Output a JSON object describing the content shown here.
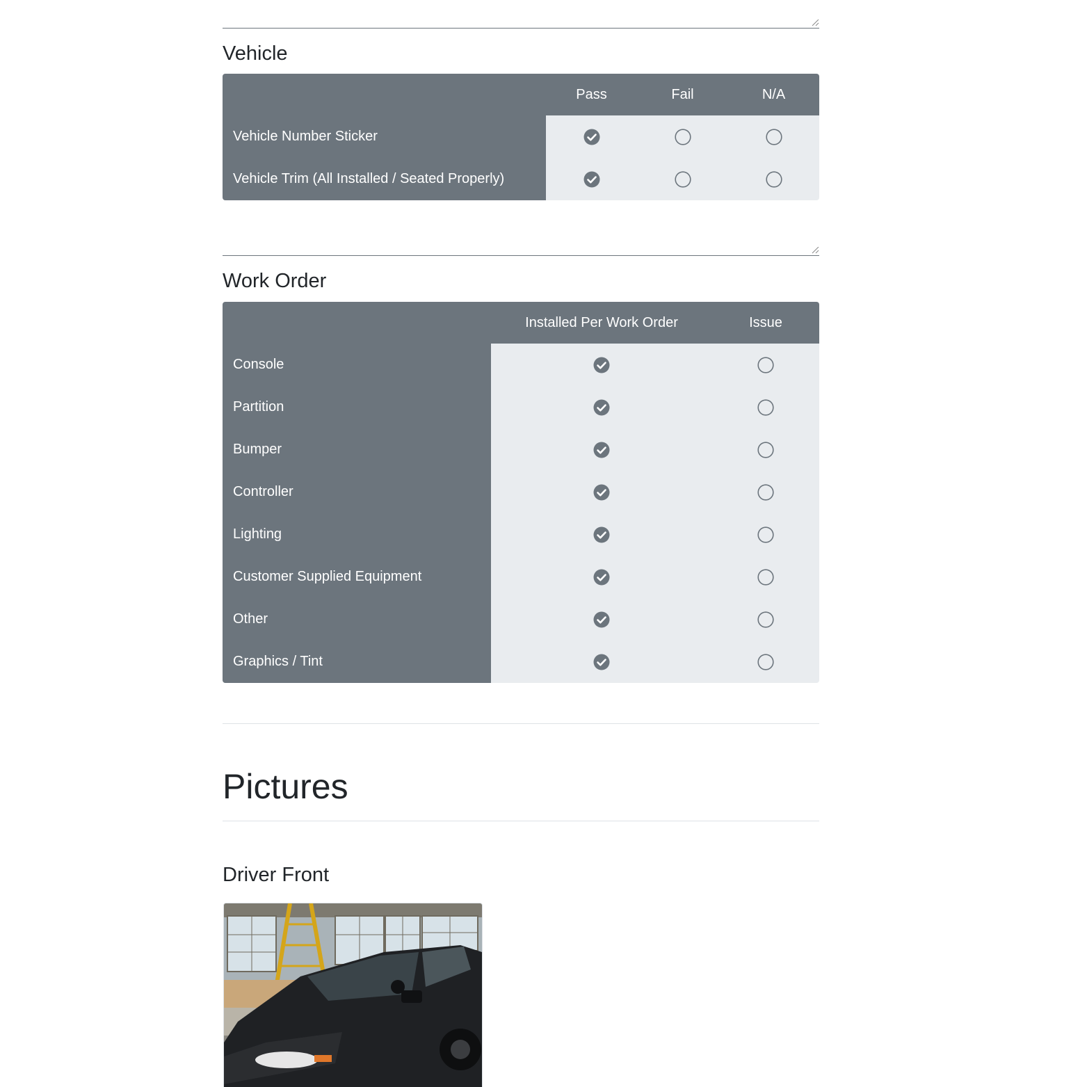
{
  "vehicle": {
    "title": "Vehicle",
    "columns": [
      "Pass",
      "Fail",
      "N/A"
    ],
    "rows": [
      {
        "label": "Vehicle Number Sticker",
        "selected": "Pass"
      },
      {
        "label": "Vehicle Trim (All Installed / Seated Properly)",
        "selected": "Pass"
      }
    ]
  },
  "work_order": {
    "title": "Work Order",
    "columns": [
      "Installed Per Work Order",
      "Issue"
    ],
    "rows": [
      {
        "label": "Console",
        "selected": "Installed Per Work Order"
      },
      {
        "label": "Partition",
        "selected": "Installed Per Work Order"
      },
      {
        "label": "Bumper",
        "selected": "Installed Per Work Order"
      },
      {
        "label": "Controller",
        "selected": "Installed Per Work Order"
      },
      {
        "label": "Lighting",
        "selected": "Installed Per Work Order"
      },
      {
        "label": "Customer Supplied Equipment",
        "selected": "Installed Per Work Order"
      },
      {
        "label": "Other",
        "selected": "Installed Per Work Order"
      },
      {
        "label": "Graphics / Tint",
        "selected": "Installed Per Work Order"
      }
    ]
  },
  "pictures": {
    "title": "Pictures",
    "items": [
      {
        "label": "Driver Front",
        "icon": "vehicle-photo"
      }
    ]
  },
  "colors": {
    "table_header": "#6c757d",
    "table_cell": "#e9ecef",
    "radio_checked": "#6c757d",
    "radio_unchecked": "#6c757d"
  }
}
